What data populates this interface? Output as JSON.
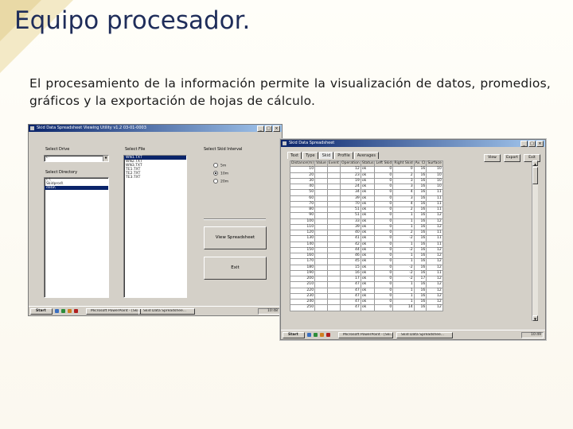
{
  "slide": {
    "title": "Equipo procesador.",
    "body": "El procesamiento de la información permite la visualización de datos, promedios, gráficos y la exportación de hojas de cálculo."
  },
  "colors": {
    "title": "#1f2d5a",
    "corner": "#e9d9a6",
    "titlebar": "#0a246a",
    "selection": "#0a246a"
  },
  "selector_window": {
    "title": "Skid Data Spreadsheet Viewing Utility v1.2 03-01-0003",
    "drive_label": "Select Drive",
    "drive_value": "c:",
    "directory_label": "Select Directory",
    "directory_items": [
      "c:\\",
      "Skidprod\\",
      "data\\"
    ],
    "file_label": "Select File",
    "file_items": [
      "WN1.TXT",
      "WN2.TXT",
      "WN3.TXT",
      "TE1.TXT",
      "TE2.TXT",
      "TE3.TXT"
    ],
    "interval_label": "Select Skid Interval",
    "interval_options": [
      "5m",
      "10m",
      "20m"
    ],
    "view_button": "View Spreadsheet",
    "exit_button": "Exit",
    "taskbar": {
      "start": "Start",
      "tasks": [
        "Microsoft PowerPoint - [Ski...",
        "Skid Data Spreadshee..."
      ],
      "clock": "10:48"
    }
  },
  "spreadsheet_window": {
    "title": "Skid Data Spreadsheet",
    "tabs": [
      "Text",
      "Type",
      "Skid",
      "Profile",
      "Averages"
    ],
    "buttons": [
      "View",
      "Export",
      "Exit"
    ],
    "columns": [
      "Distance(m)",
      "Value",
      "Event",
      "Operation",
      "Status",
      "Left Skid",
      "Right Skid",
      "Av. Cl",
      "Surface"
    ],
    "rows": [
      [
        "10",
        "",
        "",
        "12",
        "ok",
        "0",
        "0",
        "16",
        "10"
      ],
      [
        "20",
        "",
        "",
        "23",
        "ok",
        "0",
        "2",
        "16",
        "10"
      ],
      [
        "30",
        "",
        "",
        "19",
        "ok",
        "0",
        "3",
        "16",
        "10"
      ],
      [
        "40",
        "",
        "",
        "24",
        "ok",
        "0",
        "3",
        "16",
        "10"
      ],
      [
        "50",
        "",
        "",
        "34",
        "ok",
        "0",
        "4",
        "16",
        "11"
      ],
      [
        "60",
        "",
        "",
        "39",
        "ok",
        "0",
        "3",
        "16",
        "11"
      ],
      [
        "70",
        "",
        "",
        "70",
        "ok",
        "0",
        "4",
        "16",
        "11"
      ],
      [
        "80",
        "",
        "",
        "51",
        "ok",
        "0",
        "2",
        "16",
        "11"
      ],
      [
        "90",
        "",
        "",
        "51",
        "ok",
        "0",
        "1",
        "16",
        "12"
      ],
      [
        "100",
        "",
        "",
        "33",
        "ok",
        "0",
        "1",
        "16",
        "12"
      ],
      [
        "110",
        "",
        "",
        "39",
        "ok",
        "0",
        "1",
        "16",
        "12"
      ],
      [
        "120",
        "",
        "",
        "40",
        "ok",
        "0",
        "2",
        "16",
        "11"
      ],
      [
        "130",
        "",
        "",
        "41",
        "ok",
        "0",
        "-2",
        "16",
        "11"
      ],
      [
        "140",
        "",
        "",
        "42",
        "ok",
        "0",
        "1",
        "16",
        "11"
      ],
      [
        "150",
        "",
        "",
        "44",
        "ok",
        "0",
        "-2",
        "16",
        "12"
      ],
      [
        "160",
        "",
        "",
        "46",
        "ok",
        "0",
        "1",
        "16",
        "12"
      ],
      [
        "170",
        "",
        "",
        "45",
        "ok",
        "0",
        "1",
        "16",
        "12"
      ],
      [
        "180",
        "",
        "",
        "15",
        "ok",
        "0",
        "-2",
        "16",
        "12"
      ],
      [
        "190",
        "",
        "",
        "16",
        "ok",
        "0",
        "-2",
        "16",
        "11"
      ],
      [
        "200",
        "",
        "",
        "17",
        "ok",
        "0",
        "-2",
        "17",
        "12"
      ],
      [
        "210",
        "",
        "",
        "47",
        "ok",
        "0",
        "1",
        "16",
        "12"
      ],
      [
        "220",
        "",
        "",
        "47",
        "ok",
        "0",
        "1",
        "16",
        "12"
      ],
      [
        "230",
        "",
        "",
        "47",
        "ok",
        "0",
        "1",
        "16",
        "12"
      ],
      [
        "240",
        "",
        "",
        "47",
        "ok",
        "0",
        "1",
        "16",
        "12"
      ],
      [
        "250",
        "",
        "",
        "47",
        "ok",
        "0",
        "14",
        "16",
        "12"
      ]
    ],
    "taskbar": {
      "start": "Start",
      "tasks": [
        "Microsoft PowerPoint - [Ski...",
        "Skid Data Spreadshee..."
      ],
      "clock": "10:49"
    }
  }
}
